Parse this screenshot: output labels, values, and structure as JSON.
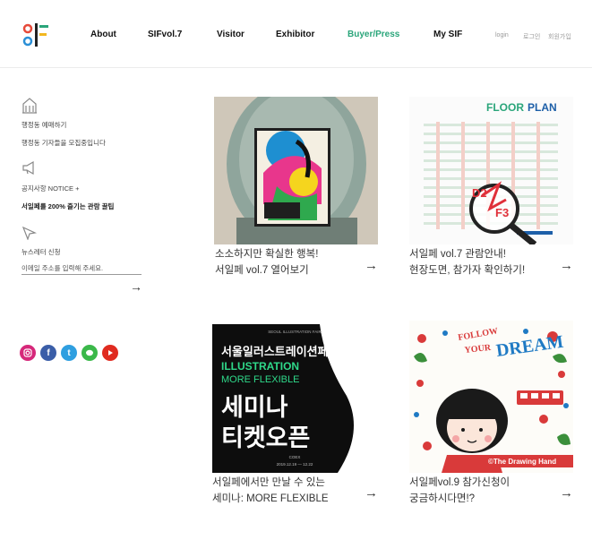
{
  "header": {
    "nav": [
      "About",
      "SIFvol.7",
      "Visitor",
      "Exhibitor",
      "Buyer/Press",
      "My SIF"
    ],
    "util": [
      "login",
      "로그인",
      "회원가입"
    ]
  },
  "sidebar": {
    "venue_title": "행정동 예매하기",
    "venue_desc": "행정동 기자들을 모집중입니다",
    "notice_title": "공지사항 NOTICE +",
    "notice_item": "서일페를 200% 즐기는 관람 꿀팁",
    "newsletter_title": "뉴스레터 신청",
    "newsletter_placeholder": "이메일 주소를 입력해 주세요."
  },
  "cards": [
    {
      "line1": "소소하지만 확실한 행복!",
      "line2": "서일페 vol.7 열어보기"
    },
    {
      "line1": "서일페 vol.7 관람안내!",
      "line2": "현장도면, 참가자 확인하기!"
    },
    {
      "line1": "서일페에서만 만날 수 있는",
      "line2": "세미나: MORE FLEXIBLE"
    },
    {
      "line1": "서일페vol.9 참가신청이",
      "line2": "궁금하시다면!?"
    }
  ],
  "floorplan": {
    "title_a": "FLOOR",
    "title_b": "PLAN",
    "label_1": "D2",
    "label_2": "F3"
  },
  "seminar": {
    "top": "SEOUL ILLUSTRATION FAIR",
    "title_ko": "서울일러스트레이션페어",
    "title_en1": "ILLUSTRATION",
    "title_en2": "MORE FLEXIBLE",
    "big1": "세미나",
    "big2": "티켓오픈",
    "bottom1": "COEX",
    "bottom2": "2019.12.19 — 12.22"
  },
  "poster": {
    "text1": "FOLLOW",
    "text2": "YOUR",
    "text3": "DREAM",
    "credit": "©The Drawing Hand"
  },
  "colors": {
    "accent": "#2aa57a",
    "instagram": "#d6287a",
    "facebook": "#3b5ea8",
    "twitter": "#2f9fe0",
    "kakao": "#3bb84a",
    "youtube": "#e02b20"
  }
}
